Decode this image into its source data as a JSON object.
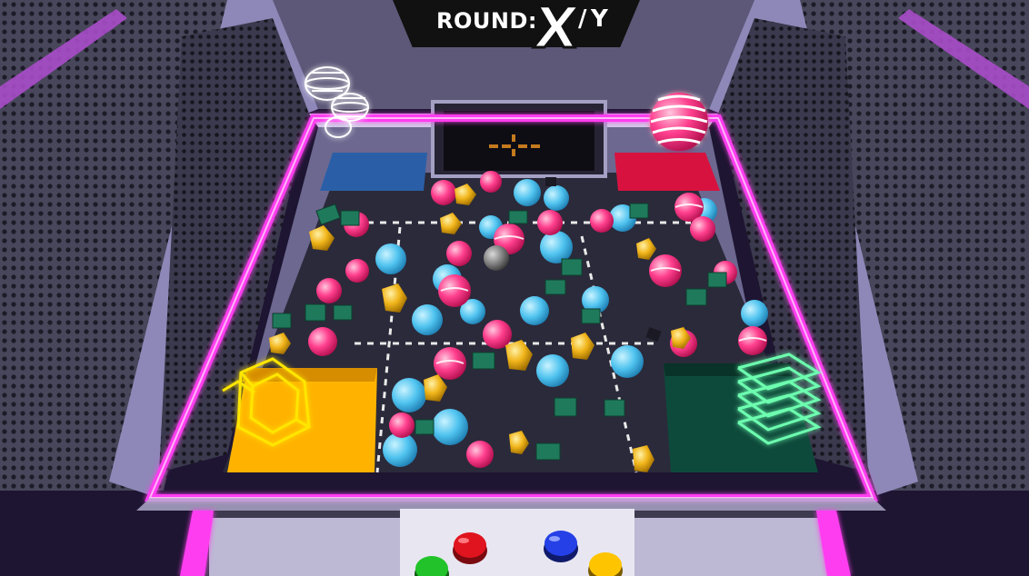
{
  "hud": {
    "round_label": "ROUND:",
    "round_current": "X",
    "round_separator": "/",
    "round_total": "Y"
  },
  "colors": {
    "neon_frame": "#ff3df0",
    "floor": "#2b2a3a",
    "chute_yellow": "#ffb300",
    "chute_green": "#0e4a3b",
    "bin_blue": "#2a5fa8",
    "bin_red": "#d8123f",
    "button_red": "#e0141e",
    "button_blue": "#2440e6",
    "button_green": "#22c32a",
    "button_yellow": "#ffc400"
  },
  "scene": {
    "prizes": [
      "plush-blue-creature",
      "plush-pink-ball",
      "gold-gem",
      "green-robot-toy",
      "pink-striped-ball"
    ],
    "hologram_icons": [
      "hologram-snowman-icon",
      "hologram-striped-ball-icon",
      "hologram-gem-icon",
      "hologram-stack-icon"
    ],
    "control_buttons": [
      "red",
      "blue",
      "green",
      "yellow"
    ]
  }
}
